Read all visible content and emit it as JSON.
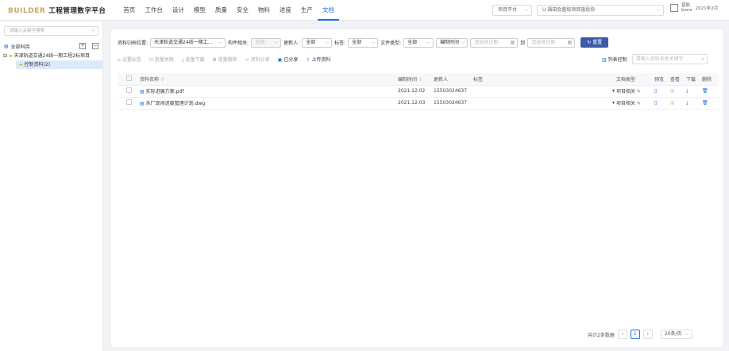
{
  "header": {
    "brand": "BUILDER",
    "system_name": "工程管理数字平台",
    "nav": [
      "首页",
      "工作台",
      "设计",
      "模型",
      "质量",
      "安全",
      "物料",
      "进度",
      "生产",
      "文档"
    ],
    "project_select": "项目平台",
    "site_select": "U 福田会盛缆项目施段协",
    "user_name_top": "曾航",
    "user_name_bottom": "bone",
    "date": "2021年2月"
  },
  "sidebar": {
    "search_placeholder": "请输入关键字搜索",
    "head_label": "全部科目",
    "tree": [
      {
        "label": "天津轨道交通24线一期工程2标项目",
        "selected": false
      },
      {
        "label": "控制资料(2)",
        "selected": true
      }
    ]
  },
  "filters": {
    "location_label": "资料归档位置:",
    "location_value": "天津轨道交通24线一期工...",
    "component_label": "构件相关:",
    "component_value": "全部",
    "uploader_label": "更新人:",
    "uploader_value": "全部",
    "tag_label": "标签:",
    "tag_value": "全部",
    "filetype_label": "文件类型:",
    "filetype_value": "全部",
    "time_label": "编制时间",
    "start_placeholder": "请选择日期",
    "to_label": "到",
    "end_placeholder": "请选择日期",
    "reset": "重置"
  },
  "toolbar": {
    "items": [
      {
        "label": "设置标签",
        "enabled": false
      },
      {
        "label": "批量关联",
        "enabled": false
      },
      {
        "label": "批量下载",
        "enabled": false
      },
      {
        "label": "批量删除",
        "enabled": false
      },
      {
        "label": "资料分享",
        "enabled": false
      },
      {
        "label": "已分享",
        "enabled": true
      },
      {
        "label": "上传资料",
        "enabled": true
      }
    ],
    "column_settings": "列表控制",
    "search_placeholder": "请输入资料名称关键字"
  },
  "table": {
    "headers": [
      "资料名称",
      "编制时间",
      "更新人",
      "标签",
      "文档类型",
      "预览",
      "查看",
      "下载",
      "删除"
    ],
    "rows": [
      {
        "name": "实际进展方案.pdf",
        "date": "2021.12.02",
        "user": "15503024637",
        "tag": "",
        "type": "项目相关"
      },
      {
        "name": "水厂现场进度管理计划.dwg",
        "date": "2021.12.03",
        "user": "15503024637",
        "tag": "",
        "type": "项目相关"
      }
    ]
  },
  "pager": {
    "total": "共计2条数据",
    "page": "1",
    "size": "20条/页"
  }
}
